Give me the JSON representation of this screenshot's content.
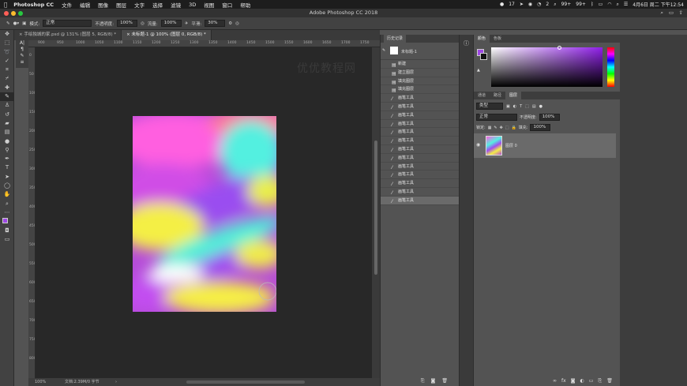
{
  "menubar": {
    "app": "Photoshop CC",
    "items": [
      "文件",
      "编辑",
      "图像",
      "图层",
      "文字",
      "选择",
      "滤镜",
      "3D",
      "视图",
      "窗口",
      "帮助"
    ],
    "status": [
      "17",
      "2",
      "99+",
      "99+",
      "4月6日 周二 下午12:54"
    ]
  },
  "window": {
    "title": "Adobe Photoshop CC 2018"
  },
  "options": {
    "mode_label": "模式:",
    "mode_value": "正常",
    "opacity_label": "不透明度:",
    "opacity_value": "100%",
    "flow_label": "流量:",
    "flow_value": "100%",
    "smooth_label": "平滑:",
    "smooth_value": "30%"
  },
  "tabs": [
    {
      "label": "手绘独城的家.psd @ 131% (图层 5, RGB/8) *",
      "active": false
    },
    {
      "label": "未标题-1 @ 100% (图层 0, RGB/8) *",
      "active": true
    }
  ],
  "ruler_top": [
    "900",
    "950",
    "1000",
    "1050",
    "1100",
    "1150",
    "1200",
    "1250",
    "1300",
    "1350",
    "1400",
    "1450",
    "1500",
    "1550",
    "1600",
    "1650",
    "1700",
    "1750"
  ],
  "ruler_left": [
    "0",
    "50",
    "100",
    "150",
    "200",
    "250",
    "300",
    "350",
    "400",
    "450",
    "500",
    "550",
    "600",
    "650",
    "700",
    "750",
    "800"
  ],
  "watermark": "优优教程网",
  "status": {
    "zoom": "100%",
    "doc": "文档:2.39M/0 字节"
  },
  "history": {
    "title": "历史记录",
    "snapshot": "未标题-1",
    "items": [
      "新建",
      "建立图层",
      "填充图层",
      "填充图层",
      "画笔工具",
      "画笔工具",
      "画笔工具",
      "画笔工具",
      "画笔工具",
      "画笔工具",
      "画笔工具",
      "画笔工具",
      "画笔工具",
      "画笔工具",
      "画笔工具",
      "画笔工具",
      "画笔工具"
    ],
    "active_index": 16
  },
  "color_panel": {
    "tabs": [
      "颜色",
      "色板"
    ],
    "fg_color": "#9f48e6",
    "bg_color": "#111111",
    "hue_color": "#8f1fe8"
  },
  "layers_panel": {
    "tabs": [
      "通道",
      "路径",
      "图层"
    ],
    "kind": "类型",
    "blend": "正常",
    "opacity_label": "不透明度:",
    "opacity_value": "100%",
    "lock_label": "锁定:",
    "fill_label": "填充:",
    "fill_value": "100%",
    "layer_name": "图层 0"
  }
}
